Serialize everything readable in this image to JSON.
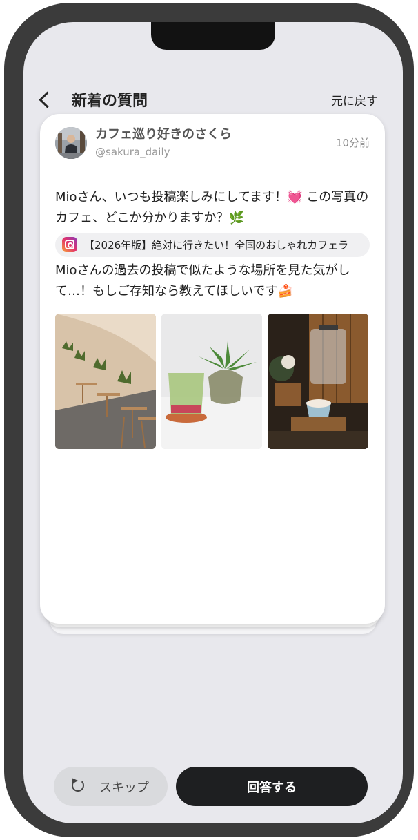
{
  "header": {
    "title": "新着の質問",
    "undo_label": "元に戻す"
  },
  "question": {
    "user_name": "カフェ巡り好きのさくら",
    "handle": "@sakura_daily",
    "time_ago": "10分前",
    "text1": "Mioさん、いつも投稿楽しみにしてます！💓 この写真のカフェ、どこか分かりますか？🌿",
    "linked_post": "【2026年版】絶対に行きたい！全国のおしゃれカフェラ",
    "text2": "Mioさんの過去の投稿で似たような場所を見た気がして…！もしご存知なら教えてほしいです🍰"
  },
  "actions": {
    "skip_label": "スキップ",
    "answer_label": "回答する"
  },
  "colors": {
    "primary_button": "#1e1f21",
    "secondary_button": "#d9dadd",
    "background": "#e8e8ed"
  }
}
